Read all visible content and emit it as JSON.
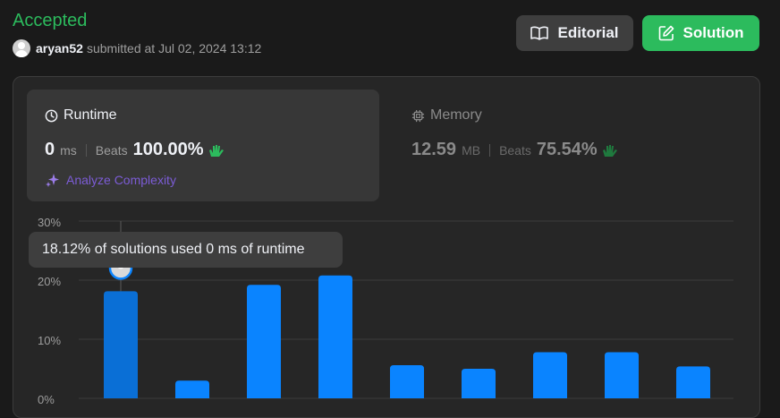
{
  "header": {
    "status": "Accepted",
    "username": "aryan52",
    "submitted_text": "submitted at Jul 02, 2024 13:12",
    "editorial_label": "Editorial",
    "solution_label": "Solution"
  },
  "runtime": {
    "title": "Runtime",
    "value": "0",
    "unit": "ms",
    "beats_label": "Beats",
    "beats_value": "100.00%",
    "analyze_label": "Analyze Complexity"
  },
  "memory": {
    "title": "Memory",
    "value": "12.59",
    "unit": "MB",
    "beats_label": "Beats",
    "beats_value": "75.54%"
  },
  "tooltip": {
    "text": "18.12% of solutions used 0 ms of runtime"
  },
  "colors": {
    "accepted": "#2cbb5d",
    "bar": "#0a84ff",
    "bar_selected": "#0a6fd6",
    "analyze": "#7c5cd6"
  },
  "chart_data": {
    "type": "bar",
    "y_tick_labels": [
      "30%",
      "20%",
      "10%",
      "0%"
    ],
    "ylim": [
      0,
      30
    ],
    "values": [
      18.12,
      3.0,
      19.2,
      20.8,
      5.6,
      5.0,
      7.8,
      7.8,
      5.4
    ],
    "selected_index": 0,
    "grid": true
  }
}
